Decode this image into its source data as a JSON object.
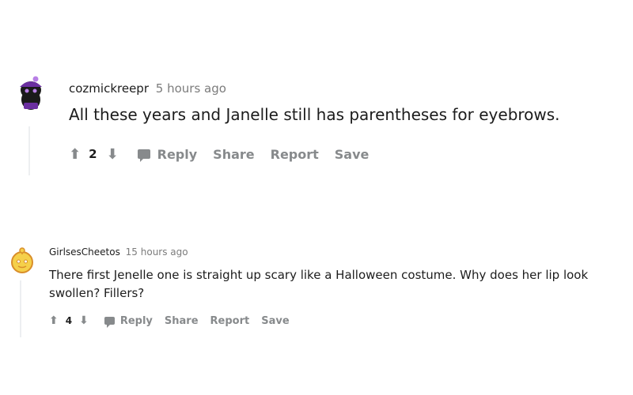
{
  "comments": [
    {
      "username": "cozmickreepr",
      "time": "5 hours ago",
      "body": "All these years and Janelle still has parentheses for eyebrows.",
      "score": "2",
      "actions": {
        "reply": "Reply",
        "share": "Share",
        "report": "Report",
        "save": "Save"
      },
      "avatar_colors": {
        "body": "#1a1a1a",
        "hat": "#6b2fa0",
        "accent": "#b87fe6"
      }
    },
    {
      "username": "GirlsesCheetos",
      "time": "15 hours ago",
      "body": "There first Jenelle one is straight up scary like a Halloween costume. Why does her lip look swollen? Fillers?",
      "score": "4",
      "actions": {
        "reply": "Reply",
        "share": "Share",
        "report": "Report",
        "save": "Save"
      },
      "avatar_colors": {
        "face": "#f5d04a",
        "outline": "#d98e2a",
        "white": "#ffffff"
      }
    }
  ],
  "icons": {
    "upvote": "arrow-up-icon",
    "downvote": "arrow-down-icon",
    "reply": "chat-bubble-icon"
  }
}
